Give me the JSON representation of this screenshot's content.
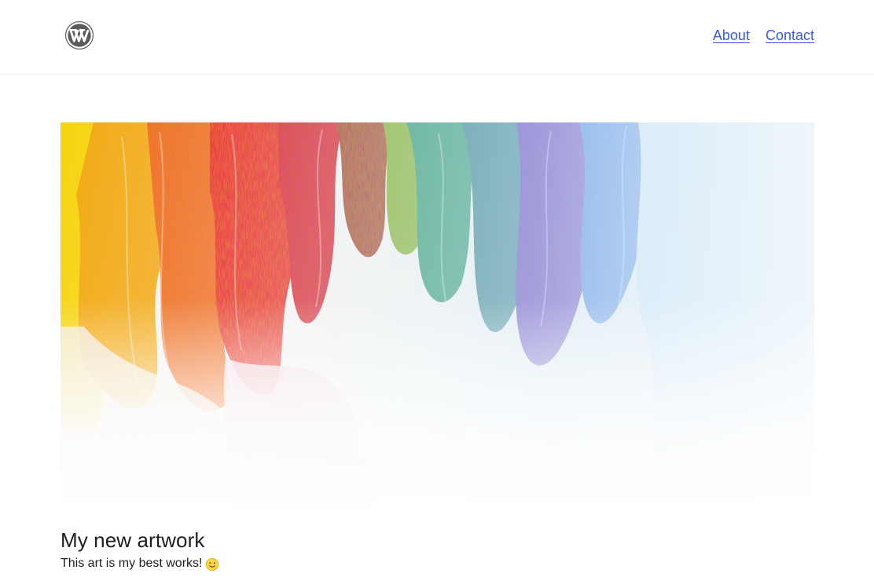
{
  "header": {
    "logo_icon": "wordpress-logo-icon",
    "nav": [
      {
        "label": "About"
      },
      {
        "label": "Contact"
      }
    ]
  },
  "post": {
    "title": "My new artwork",
    "excerpt": "This art is my best works!",
    "emoji_icon": "smiley-icon",
    "image_description_colors": [
      "#f5d22b",
      "#f28a24",
      "#d73c2e",
      "#008f6b",
      "#4d2ca0",
      "#2f75d6"
    ]
  },
  "colors": {
    "link": "#3858e9",
    "text": "#1e1e1e",
    "divider": "#ececec"
  }
}
